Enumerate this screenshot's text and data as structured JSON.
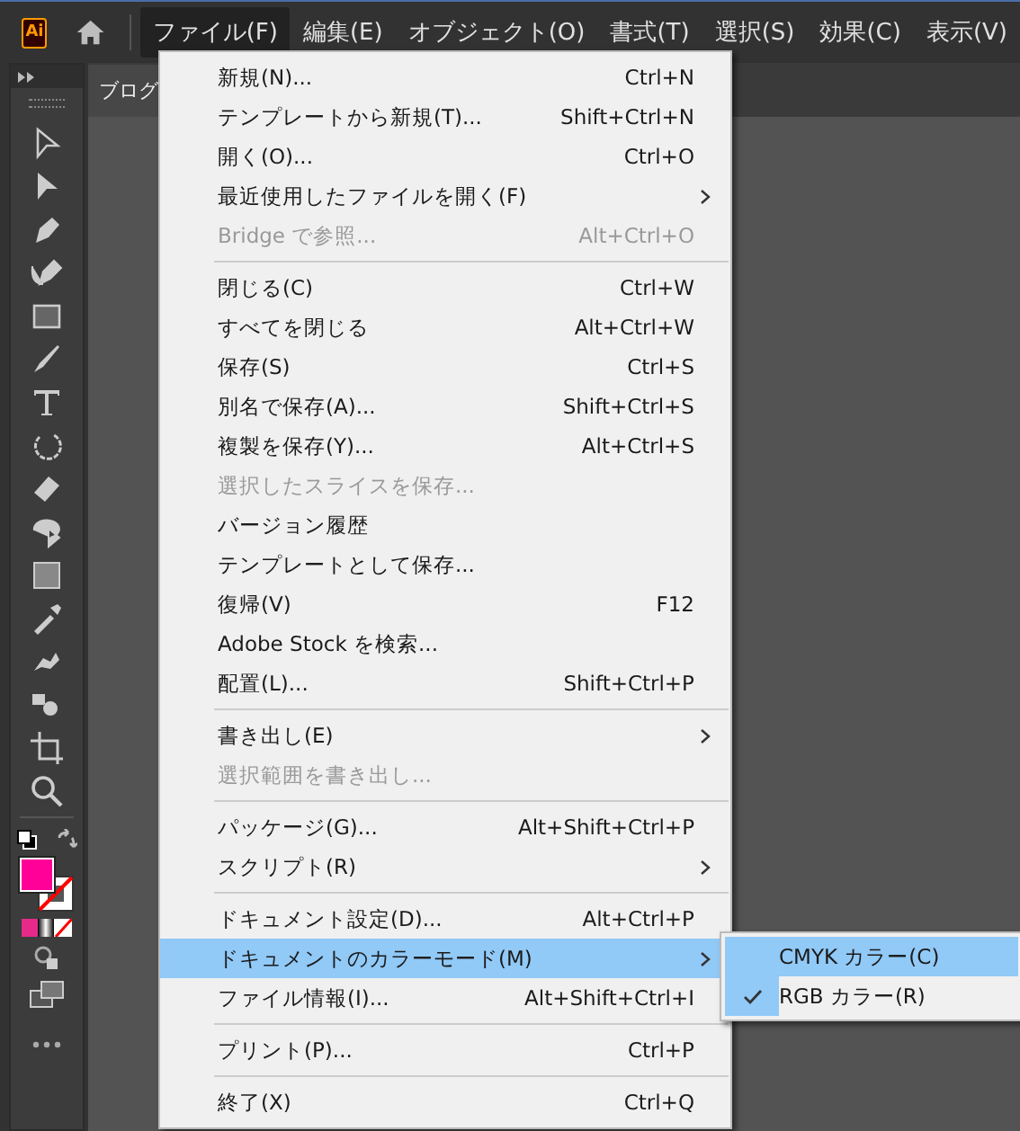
{
  "app_logo": "Ai",
  "menubar": [
    {
      "label": "ファイル(F)",
      "selected": true
    },
    {
      "label": "編集(E)",
      "selected": false
    },
    {
      "label": "オブジェクト(O)",
      "selected": false
    },
    {
      "label": "書式(T)",
      "selected": false
    },
    {
      "label": "選択(S)",
      "selected": false
    },
    {
      "label": "効果(C)",
      "selected": false
    },
    {
      "label": "表示(V)",
      "selected": false
    }
  ],
  "document_tab": {
    "label": "ブログ"
  },
  "fill_swatch": {
    "color": "#ff0099"
  },
  "file_menu": [
    {
      "kind": "item",
      "label": "新規(N)...",
      "shortcut": "Ctrl+N",
      "disabled": false,
      "submenu": false,
      "highlighted": false
    },
    {
      "kind": "item",
      "label": "テンプレートから新規(T)...",
      "shortcut": "Shift+Ctrl+N",
      "disabled": false,
      "submenu": false,
      "highlighted": false
    },
    {
      "kind": "item",
      "label": "開く(O)...",
      "shortcut": "Ctrl+O",
      "disabled": false,
      "submenu": false,
      "highlighted": false
    },
    {
      "kind": "item",
      "label": "最近使用したファイルを開く(F)",
      "disabled": false,
      "submenu": true,
      "highlighted": false
    },
    {
      "kind": "item",
      "label": "Bridge で参照...",
      "shortcut": "Alt+Ctrl+O",
      "disabled": true,
      "submenu": false,
      "highlighted": false
    },
    {
      "kind": "separator"
    },
    {
      "kind": "item",
      "label": "閉じる(C)",
      "shortcut": "Ctrl+W",
      "disabled": false,
      "submenu": false,
      "highlighted": false
    },
    {
      "kind": "item",
      "label": "すべてを閉じる",
      "shortcut": "Alt+Ctrl+W",
      "disabled": false,
      "submenu": false,
      "highlighted": false
    },
    {
      "kind": "item",
      "label": "保存(S)",
      "shortcut": "Ctrl+S",
      "disabled": false,
      "submenu": false,
      "highlighted": false
    },
    {
      "kind": "item",
      "label": "別名で保存(A)...",
      "shortcut": "Shift+Ctrl+S",
      "disabled": false,
      "submenu": false,
      "highlighted": false
    },
    {
      "kind": "item",
      "label": "複製を保存(Y)...",
      "shortcut": "Alt+Ctrl+S",
      "disabled": false,
      "submenu": false,
      "highlighted": false
    },
    {
      "kind": "item",
      "label": "選択したスライスを保存...",
      "disabled": true,
      "submenu": false,
      "highlighted": false
    },
    {
      "kind": "item",
      "label": "バージョン履歴",
      "disabled": false,
      "submenu": false,
      "highlighted": false
    },
    {
      "kind": "item",
      "label": "テンプレートとして保存...",
      "disabled": false,
      "submenu": false,
      "highlighted": false
    },
    {
      "kind": "item",
      "label": "復帰(V)",
      "shortcut": "F12",
      "disabled": false,
      "submenu": false,
      "highlighted": false
    },
    {
      "kind": "item",
      "label": "Adobe Stock を検索...",
      "disabled": false,
      "submenu": false,
      "highlighted": false
    },
    {
      "kind": "item",
      "label": "配置(L)...",
      "shortcut": "Shift+Ctrl+P",
      "disabled": false,
      "submenu": false,
      "highlighted": false
    },
    {
      "kind": "separator"
    },
    {
      "kind": "item",
      "label": "書き出し(E)",
      "disabled": false,
      "submenu": true,
      "highlighted": false
    },
    {
      "kind": "item",
      "label": "選択範囲を書き出し...",
      "disabled": true,
      "submenu": false,
      "highlighted": false
    },
    {
      "kind": "separator"
    },
    {
      "kind": "item",
      "label": "パッケージ(G)...",
      "shortcut": "Alt+Shift+Ctrl+P",
      "disabled": false,
      "submenu": false,
      "highlighted": false
    },
    {
      "kind": "item",
      "label": "スクリプト(R)",
      "disabled": false,
      "submenu": true,
      "highlighted": false
    },
    {
      "kind": "separator"
    },
    {
      "kind": "item",
      "label": "ドキュメント設定(D)...",
      "shortcut": "Alt+Ctrl+P",
      "disabled": false,
      "submenu": false,
      "highlighted": false
    },
    {
      "kind": "item",
      "label": "ドキュメントのカラーモード(M)",
      "disabled": false,
      "submenu": true,
      "highlighted": true
    },
    {
      "kind": "item",
      "label": "ファイル情報(I)...",
      "shortcut": "Alt+Shift+Ctrl+I",
      "disabled": false,
      "submenu": false,
      "highlighted": false
    },
    {
      "kind": "separator"
    },
    {
      "kind": "item",
      "label": "プリント(P)...",
      "shortcut": "Ctrl+P",
      "disabled": false,
      "submenu": false,
      "highlighted": false
    },
    {
      "kind": "separator"
    },
    {
      "kind": "item",
      "label": "終了(X)",
      "shortcut": "Ctrl+Q",
      "disabled": false,
      "submenu": false,
      "highlighted": false
    }
  ],
  "color_mode_submenu": [
    {
      "label": "CMYK カラー(C)",
      "checked": false,
      "highlighted": true
    },
    {
      "label": "RGB カラー(R)",
      "checked": true,
      "highlighted": false
    }
  ]
}
